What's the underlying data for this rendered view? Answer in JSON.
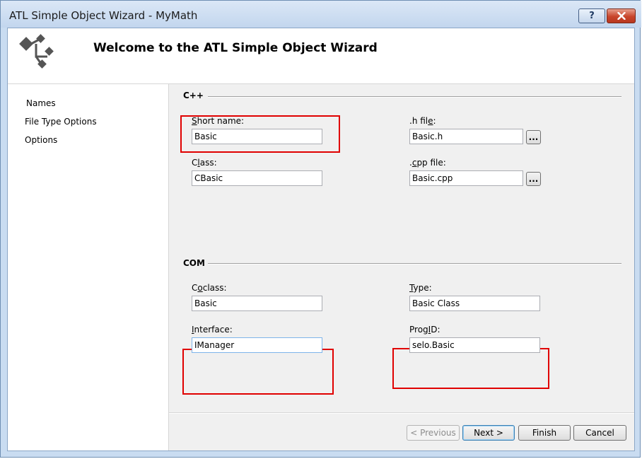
{
  "window": {
    "title": "ATL Simple Object Wizard - MyMath",
    "help_label": "?",
    "close_label": "✕"
  },
  "header": {
    "title": "Welcome to the ATL Simple Object Wizard",
    "logo_icon": "wizard-arrows-icon"
  },
  "sidebar": {
    "items": [
      {
        "label": "Names"
      },
      {
        "label": "File Type Options"
      },
      {
        "label": "Options"
      }
    ]
  },
  "cpp": {
    "section_label": "C++",
    "short_name": {
      "label_accel": "S",
      "label_rest": "hort name:",
      "value": "Basic"
    },
    "class": {
      "label_pre": "C",
      "label_accel": "l",
      "label_rest": "ass:",
      "value": "CBasic"
    },
    "h_file": {
      "label_pre": ".h fil",
      "label_accel": "e",
      "label_rest": ":",
      "value": "Basic.h",
      "browse_label": "..."
    },
    "cpp_file": {
      "label_pre": ".",
      "label_accel": "c",
      "label_rest": "pp file:",
      "value": "Basic.cpp",
      "browse_label": "..."
    }
  },
  "com": {
    "section_label": "COM",
    "coclass": {
      "label_pre": "C",
      "label_accel": "o",
      "label_rest": "class:",
      "value": "Basic"
    },
    "type": {
      "label_accel": "T",
      "label_rest": "ype:",
      "value": "Basic Class"
    },
    "interface": {
      "label_accel": "I",
      "label_rest": "nterface:",
      "value": "IManager"
    },
    "progid": {
      "label_pre": "Prog",
      "label_accel": "I",
      "label_rest": "D:",
      "value": "selo.Basic"
    }
  },
  "buttons": {
    "previous": "< Previous",
    "next": "Next >",
    "finish": "Finish",
    "cancel": "Cancel"
  },
  "colors": {
    "highlight": "#e00000",
    "titlebar": "#c2d6ee",
    "close_button": "#c8452b"
  }
}
